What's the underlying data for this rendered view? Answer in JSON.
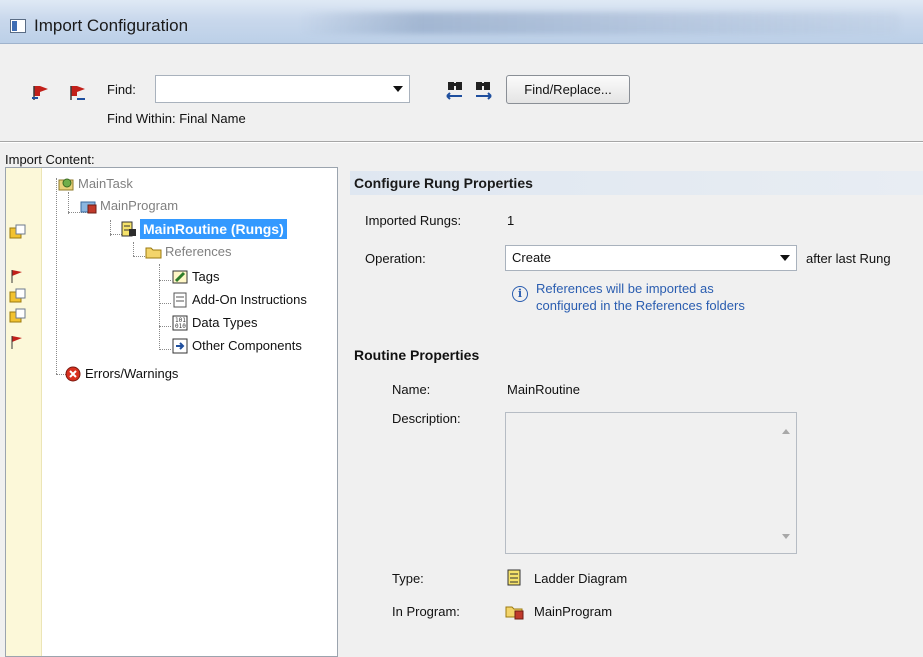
{
  "window": {
    "title": "Import Configuration"
  },
  "toolbar": {
    "find_label": "Find:",
    "find_value": "",
    "find_within": "Find Within: Final Name",
    "find_replace_button": "Find/Replace..."
  },
  "tree": {
    "label": "Import Content:",
    "items": [
      {
        "label": "MainTask"
      },
      {
        "label": "MainProgram"
      },
      {
        "label": "MainRoutine (Rungs)"
      },
      {
        "label": "References"
      },
      {
        "label": "Tags"
      },
      {
        "label": "Add-On Instructions"
      },
      {
        "label": "Data Types"
      },
      {
        "label": "Other Components"
      },
      {
        "label": "Errors/Warnings"
      }
    ]
  },
  "rung_props": {
    "header": "Configure Rung Properties",
    "imported_rungs_label": "Imported Rungs:",
    "imported_rungs_value": "1",
    "operation_label": "Operation:",
    "operation_value": "Create",
    "operation_suffix": "after last Rung",
    "info_line1": "References will be imported as",
    "info_line2": "configured in the References folders"
  },
  "routine_props": {
    "header": "Routine Properties",
    "name_label": "Name:",
    "name_value": "MainRoutine",
    "description_label": "Description:",
    "description_value": "",
    "type_label": "Type:",
    "type_value": "Ladder Diagram",
    "program_label": "In Program:",
    "program_value": "MainProgram"
  },
  "colors": {
    "selection": "#3399ff",
    "info_text": "#2a5db0",
    "gutter": "#fcf8d9"
  }
}
